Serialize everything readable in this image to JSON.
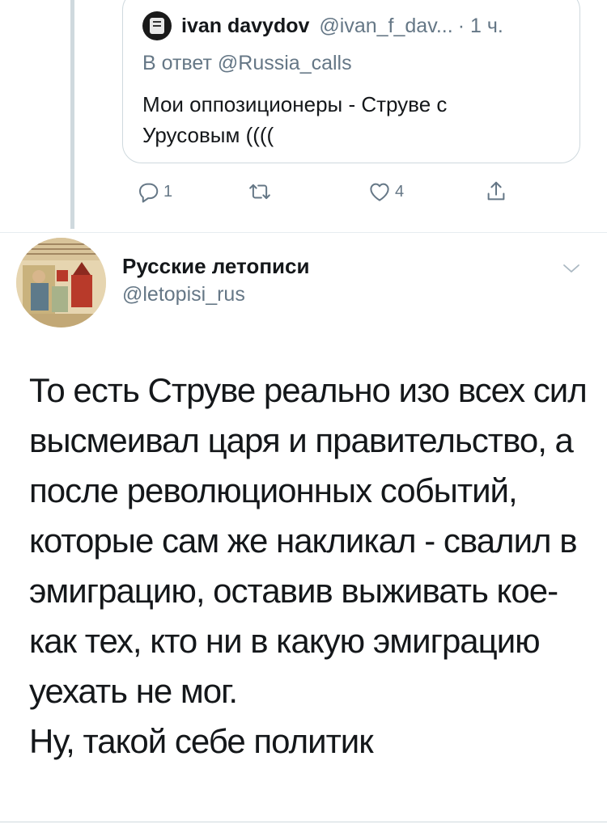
{
  "quoted_tweet": {
    "author_name": "ivan davydov",
    "author_handle": "@ivan_f_dav...",
    "time": "· 1 ч.",
    "reply_to": "В ответ @Russia_calls",
    "body": "Мои оппозиционеры - Струве с Урусовым ((((",
    "icons": {
      "avatar": "avatar-image"
    }
  },
  "actions": {
    "reply_count": "1",
    "retweet_count": "",
    "like_count": "4",
    "icons": [
      "reply-icon",
      "retweet-icon",
      "like-icon",
      "share-icon"
    ]
  },
  "main_tweet": {
    "author_name": "Русские летописи",
    "author_handle": "@letopisi_rus",
    "body_paragraph_1": "То есть Струве реально изо всех сил высмеивал царя и правительство, а после революционных событий, которые сам же накликал - свалил в эмиграцию, оставив выживать кое-как тех, кто ни в какую эмиграцию уехать не мог.",
    "body_paragraph_2": "Ну, такой себе политик"
  },
  "colors": {
    "text": "#14171a",
    "secondary": "#657786",
    "border": "#cfd9de"
  }
}
